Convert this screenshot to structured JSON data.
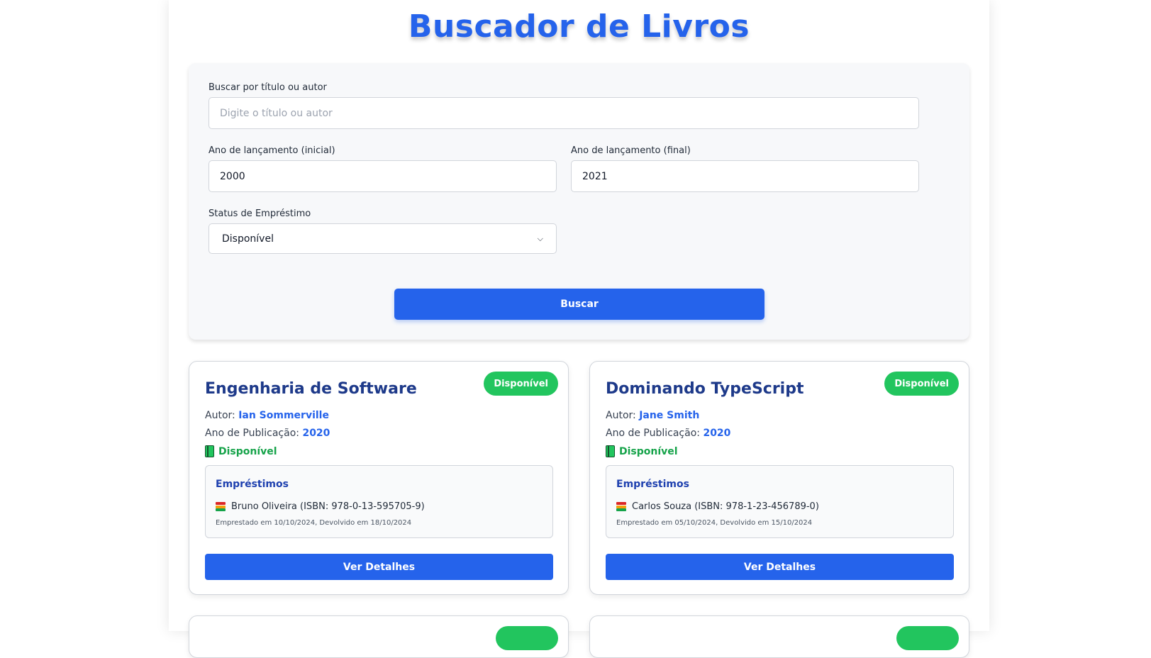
{
  "header": {
    "title": "Buscador de Livros"
  },
  "search": {
    "query_label": "Buscar por título ou autor",
    "query_placeholder": "Digite o título ou autor",
    "query_value": "",
    "year_start_label": "Ano de lançamento (inicial)",
    "year_start_value": "2000",
    "year_end_label": "Ano de lançamento (final)",
    "year_end_value": "2021",
    "status_label": "Status de Empréstimo",
    "status_selected": "Disponível",
    "submit_label": "Buscar"
  },
  "books": [
    {
      "badge": "Disponível",
      "title": "Engenharia de Software",
      "author_label": "Autor:",
      "author": "Ian Sommerville",
      "year_label": "Ano de Publicação:",
      "year": "2020",
      "availability": "Disponível",
      "loans_title": "Empréstimos",
      "loan_text": "Bruno Oliveira (ISBN: 978-0-13-595705-9)",
      "loan_dates": "Emprestado em 10/10/2024, Devolvido em 18/10/2024",
      "details_label": "Ver Detalhes"
    },
    {
      "badge": "Disponível",
      "title": "Dominando TypeScript",
      "author_label": "Autor:",
      "author": "Jane Smith",
      "year_label": "Ano de Publicação:",
      "year": "2020",
      "availability": "Disponível",
      "loans_title": "Empréstimos",
      "loan_text": "Carlos Souza (ISBN: 978-1-23-456789-0)",
      "loan_dates": "Emprestado em 05/10/2024, Devolvido em 15/10/2024",
      "details_label": "Ver Detalhes"
    }
  ],
  "colors": {
    "accent": "#2563eb",
    "badge_green": "#22c55e",
    "title_navy": "#1e3a8a"
  }
}
